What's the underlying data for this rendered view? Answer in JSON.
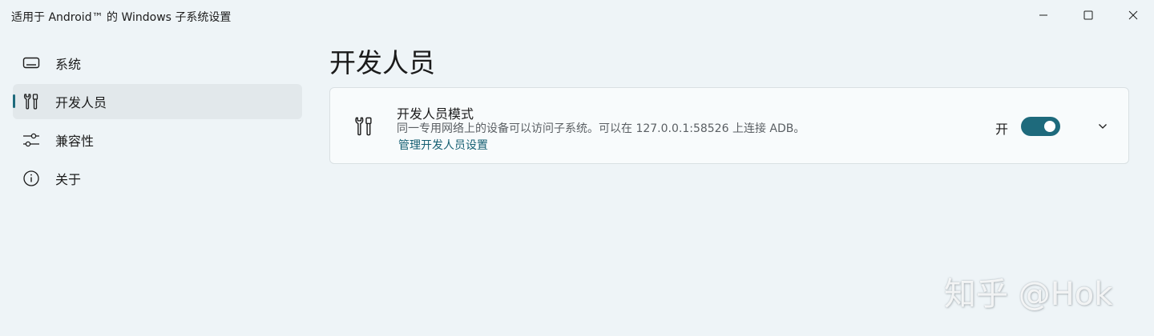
{
  "window": {
    "title": "适用于 Android™ 的 Windows 子系统设置"
  },
  "sidebar": {
    "items": [
      {
        "label": "系统",
        "icon": "laptop-icon",
        "selected": false
      },
      {
        "label": "开发人员",
        "icon": "developer-tools-icon",
        "selected": true
      },
      {
        "label": "兼容性",
        "icon": "sliders-icon",
        "selected": false
      },
      {
        "label": "关于",
        "icon": "info-icon",
        "selected": false
      }
    ]
  },
  "main": {
    "title": "开发人员",
    "developer_mode": {
      "title": "开发人员模式",
      "description": "同一专用网络上的设备可以访问子系统。可以在 127.0.0.1:58526 上连接 ADB。",
      "link": "管理开发人员设置",
      "toggle_state_label": "开",
      "toggle_on": true
    }
  },
  "watermark": "知乎 @Hok",
  "colors": {
    "accent": "#1e6a7c",
    "background": "#eef4f7",
    "card": "#f8fbfc",
    "link": "#155f72"
  }
}
